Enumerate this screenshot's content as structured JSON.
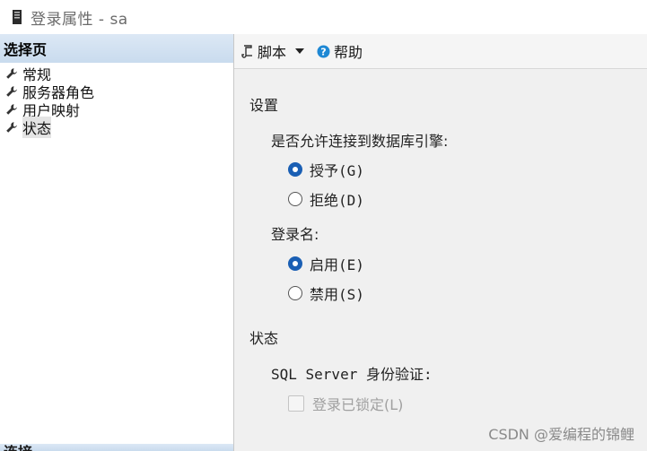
{
  "window": {
    "title": "登录属性 - sa"
  },
  "left_pane": {
    "header": "选择页",
    "items": [
      {
        "label": "常规"
      },
      {
        "label": "服务器角色"
      },
      {
        "label": "用户映射"
      },
      {
        "label": "状态",
        "active": true
      }
    ],
    "bottom_header": "连接"
  },
  "toolbar": {
    "script_label": "脚本",
    "help_label": "帮助"
  },
  "settings": {
    "section_title": "设置",
    "permission_label": "是否允许连接到数据库引擎:",
    "permission_options": [
      "授予(G)",
      "拒绝(D)"
    ],
    "permission_selected": "授予(G)",
    "login_label": "登录名:",
    "login_options": [
      "启用(E)",
      "禁用(S)"
    ],
    "login_selected": "启用(E)"
  },
  "status": {
    "section_title": "状态",
    "auth_label": "SQL Server 身份验证:",
    "locked_label": "登录已锁定(L)",
    "locked_checked": false,
    "locked_disabled": true
  },
  "watermark": "CSDN @爱编程的锦鲤",
  "colors": {
    "header_bg": "#c9dbee",
    "radio_accent": "#1a5fb4",
    "pane_bg": "#f0f0f0"
  }
}
